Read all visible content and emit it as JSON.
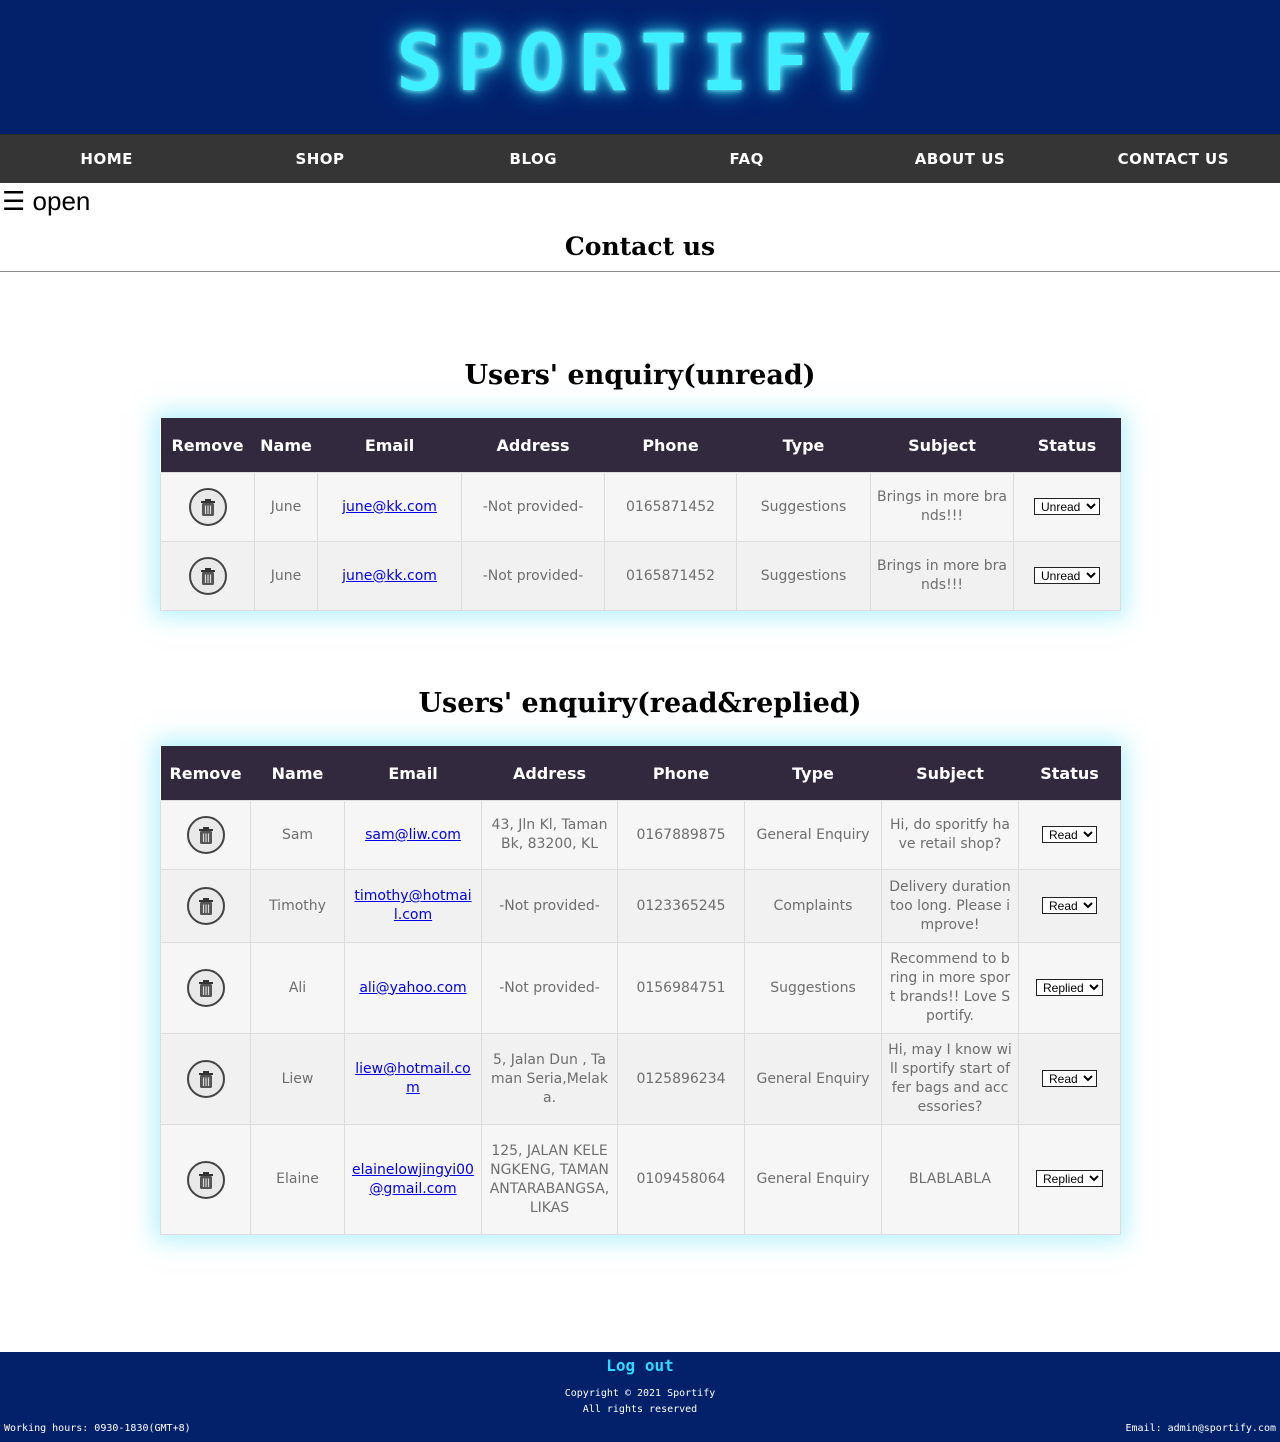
{
  "header": {
    "logo": "SPORTIFY"
  },
  "nav": {
    "items": [
      {
        "label": "HOME"
      },
      {
        "label": "SHOP"
      },
      {
        "label": "BLOG"
      },
      {
        "label": "FAQ"
      },
      {
        "label": "ABOUT US"
      },
      {
        "label": "CONTACT US"
      }
    ]
  },
  "menu_toggle": {
    "label": "☰ open"
  },
  "page_title": "Contact us",
  "unread": {
    "title": "Users' enquiry(unread)",
    "headers": [
      "Remove",
      "Name",
      "Email",
      "Address",
      "Phone",
      "Type",
      "Subject",
      "Status"
    ],
    "rows": [
      {
        "name": "June",
        "email": "june@kk.com",
        "address": "-Not provided-",
        "phone": "0165871452",
        "type": "Suggestions",
        "subject": "Brings in more brands!!!",
        "status": "Unread"
      },
      {
        "name": "June",
        "email": "june@kk.com",
        "address": "-Not provided-",
        "phone": "0165871452",
        "type": "Suggestions",
        "subject": "Brings in more brands!!!",
        "status": "Unread"
      }
    ]
  },
  "read": {
    "title": "Users' enquiry(read&replied)",
    "headers": [
      "Remove",
      "Name",
      "Email",
      "Address",
      "Phone",
      "Type",
      "Subject",
      "Status"
    ],
    "rows": [
      {
        "name": "Sam",
        "email": "sam@liw.com",
        "address": "43, Jln Kl, Taman Bk, 83200, KL",
        "phone": "0167889875",
        "type": "General Enquiry",
        "subject": "Hi, do sporitfy have retail shop?",
        "status": "Read"
      },
      {
        "name": "Timothy",
        "email": "timothy@hotmail.com",
        "address": "-Not provided-",
        "phone": "0123365245",
        "type": "Complaints",
        "subject": "Delivery duration too long. Please improve!",
        "status": "Read"
      },
      {
        "name": "Ali",
        "email": "ali@yahoo.com",
        "address": "-Not provided-",
        "phone": "0156984751",
        "type": "Suggestions",
        "subject": "Recommend to bring in more sport brands!! Love Sportify.",
        "status": "Replied"
      },
      {
        "name": "Liew",
        "email": "liew@hotmail.com",
        "address": "5, Jalan Dun , Taman Seria,Melaka.",
        "phone": "0125896234",
        "type": "General Enquiry",
        "subject": "Hi, may I know will sportify start offer bags and accessories?",
        "status": "Read"
      },
      {
        "name": "Elaine",
        "email": "elainelowjingyi00@gmail.com",
        "address": "125, JALAN KELENGKENG, TAMAN ANTARABANGSA, LIKAS",
        "phone": "0109458064",
        "type": "General Enquiry",
        "subject": "BLABLABLA",
        "status": "Replied"
      }
    ]
  },
  "status_options": [
    "Unread",
    "Read",
    "Replied"
  ],
  "footer": {
    "logout": "Log out",
    "copyright_line1": "Copyright © 2021 Sportify",
    "copyright_line2": "All rights reserved",
    "working_hours": "Working hours: 0930-1830(GMT+8)",
    "email": "Email: admin@sportify.com"
  },
  "icons": {
    "remove": "trash-bin-icon",
    "menu": "hamburger-icon"
  },
  "colors": {
    "header_bg": "#03206b",
    "nav_bg": "#353535",
    "table_header_bg": "#33293f",
    "logo": "#3ef0ff",
    "logout": "#2bdcff"
  }
}
